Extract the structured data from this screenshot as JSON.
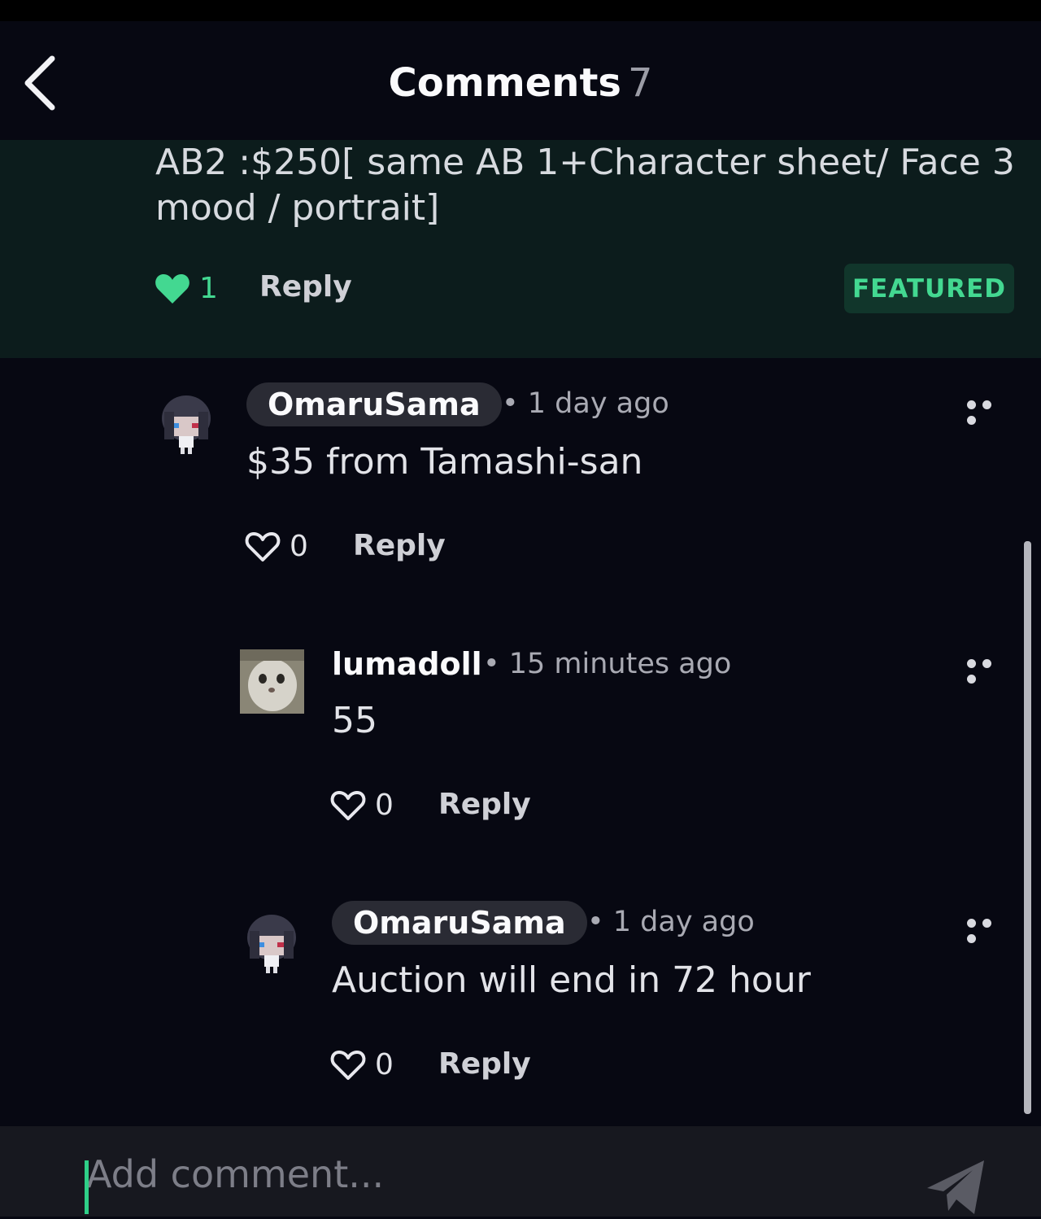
{
  "header": {
    "title": "Comments",
    "count": "7"
  },
  "featured": {
    "text": "AB2 :$250[ same AB 1+Character sheet/ Face 3 mood / portrait]",
    "likes": "1",
    "reply_label": "Reply",
    "badge": "FEATURED"
  },
  "comments": [
    {
      "username": "OmaruSama",
      "time": "• 1 day ago",
      "body": "$35 from Tamashi-san",
      "likes": "0",
      "reply_label": "Reply"
    },
    {
      "username": "lumadoll",
      "time": "• 15 minutes ago",
      "body": "55",
      "likes": "0",
      "reply_label": "Reply"
    },
    {
      "username": "OmaruSama",
      "time": "• 1 day ago",
      "body": "Auction will end in 72 hour",
      "likes": "0",
      "reply_label": "Reply"
    }
  ],
  "composer": {
    "placeholder": "Add comment..."
  },
  "colors": {
    "accent": "#43d891",
    "featured_bg": "#0c1c1c",
    "background": "#070812"
  },
  "icons": [
    "back-icon",
    "heart-filled-icon",
    "heart-outline-icon",
    "more-icon",
    "send-icon"
  ]
}
